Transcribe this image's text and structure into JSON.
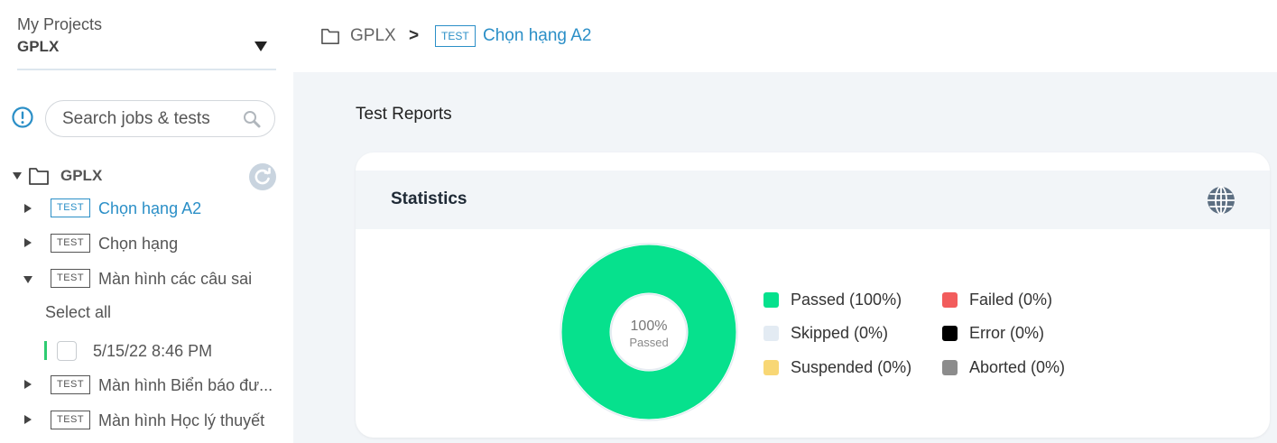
{
  "sidebar": {
    "project_label": "My Projects",
    "project_name": "GPLX",
    "search_placeholder": "Search jobs & tests",
    "root": "GPLX",
    "badge": "TEST",
    "items": [
      {
        "label": "Chọn hạng A2"
      },
      {
        "label": "Chọn hạng"
      },
      {
        "label": "Màn hình các câu sai"
      },
      {
        "label": "Màn hình Biển báo đư..."
      },
      {
        "label": "Màn hình Học lý thuyết"
      }
    ],
    "select_all": "Select all",
    "run_date": "5/15/22 8:46 PM"
  },
  "breadcrumb": {
    "root": "GPLX",
    "separator": ">",
    "badge": "TEST",
    "current": "Chọn hạng A2"
  },
  "main": {
    "reports_title": "Test Reports",
    "stats_title": "Statistics",
    "donut_percent": "100%",
    "donut_label": "Passed",
    "legend": [
      {
        "label": "Passed (100%)",
        "color": "#06e18d"
      },
      {
        "label": "Failed (0%)",
        "color": "#f25c5c"
      },
      {
        "label": "Skipped (0%)",
        "color": "#e3ebf3"
      },
      {
        "label": "Error (0%)",
        "color": "#000000"
      },
      {
        "label": "Suspended (0%)",
        "color": "#f8d775"
      },
      {
        "label": "Aborted (0%)",
        "color": "#8c8c8c"
      }
    ]
  },
  "colors": {
    "accent": "#2b8fc7",
    "passed": "#06e18d",
    "run_indicator": "#2ecc71"
  }
}
